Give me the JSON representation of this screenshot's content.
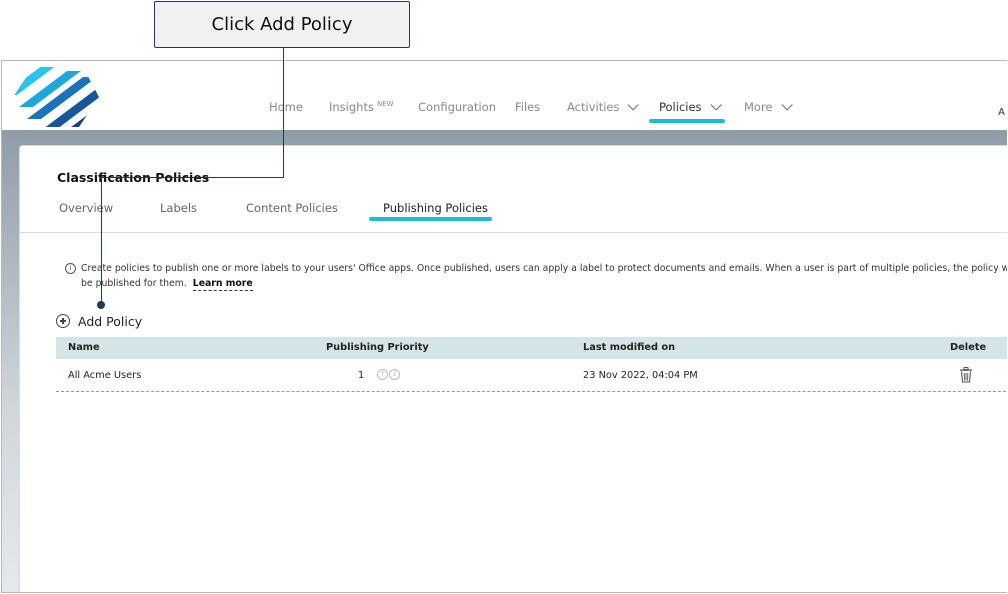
{
  "callout": {
    "text": "Click Add Policy"
  },
  "nav": {
    "items": [
      {
        "label": "Home"
      },
      {
        "label": "Insights",
        "badge": "NEW"
      },
      {
        "label": "Configuration"
      },
      {
        "label": "Files"
      },
      {
        "label": "Activities"
      },
      {
        "label": "Policies"
      },
      {
        "label": "More"
      }
    ],
    "active": "Policies",
    "right_text": "A"
  },
  "page": {
    "title": "Classification Policies",
    "tabs": [
      {
        "label": "Overview"
      },
      {
        "label": "Labels"
      },
      {
        "label": "Content Policies"
      },
      {
        "label": "Publishing Policies"
      }
    ],
    "active_tab": "Publishing Policies",
    "info_line1": "Create policies to publish one or more labels to your users' Office apps. Once published, users can apply a label to protect documents and emails. When a user is part of multiple policies, the policy with the hig",
    "info_line2": "be published for them.",
    "learn_more": "Learn more",
    "add_policy": "Add Policy"
  },
  "table": {
    "headers": [
      "Name",
      "Publishing Priority",
      "Last modified on",
      "Delete"
    ],
    "rows": [
      {
        "name": "All Acme Users",
        "priority": "1",
        "modified": "23 Nov 2022, 04:04 PM"
      }
    ]
  },
  "colors": {
    "accent": "#1fb8e0",
    "header_bg": "#d4e5e7",
    "callout_border": "#1f3a60"
  },
  "icons": {
    "logo": "stripes-hexagon-logo",
    "info": "info-icon",
    "add": "plus-circle-icon",
    "delete": "trash-icon"
  }
}
